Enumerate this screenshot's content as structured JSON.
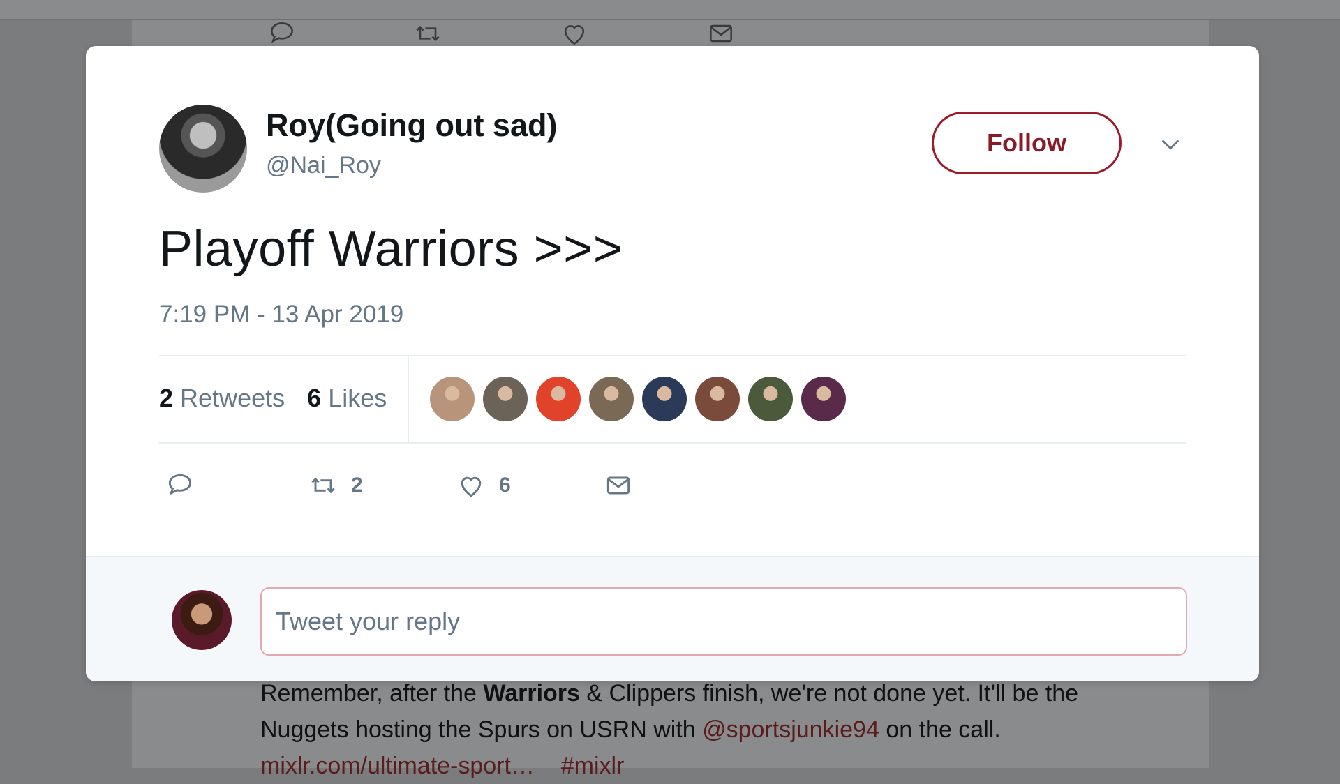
{
  "background": {
    "tweet_line1_pre": "Remember, after the ",
    "tweet_line1_bold": "Warriors",
    "tweet_line1_post": " & Clippers finish, we're not done yet. It'll be the",
    "tweet_line2_pre": "Nuggets hosting the Spurs on USRN with ",
    "tweet_line2_mention": "@sportsjunkie94",
    "tweet_line2_post": " on the call.",
    "tweet_line3_link": "mixlr.com/ultimate-sport…",
    "tweet_line3_hashtag": "#mixlr"
  },
  "tweet": {
    "author_name": "Roy(Going out sad)",
    "author_handle": "@Nai_Roy",
    "follow_label": "Follow",
    "text": "Playoff Warriors >>>",
    "timestamp": "7:19 PM - 13 Apr 2019",
    "retweet_count": "2",
    "retweets_label": "Retweets",
    "like_count": "6",
    "likes_label": "Likes",
    "action_retweet_count": "2",
    "action_like_count": "6"
  },
  "likers": [
    {
      "color": "#b8957a"
    },
    {
      "color": "#6b6258"
    },
    {
      "color": "#e0422a"
    },
    {
      "color": "#7a6a55"
    },
    {
      "color": "#2c3a5a"
    },
    {
      "color": "#7a4a3a"
    },
    {
      "color": "#4a5a3a"
    },
    {
      "color": "#5a2a4a"
    }
  ],
  "reply": {
    "placeholder": "Tweet your reply"
  },
  "colors": {
    "accent": "#8b1a26",
    "muted_text": "#657786",
    "overlay": "#7b7c7d"
  }
}
